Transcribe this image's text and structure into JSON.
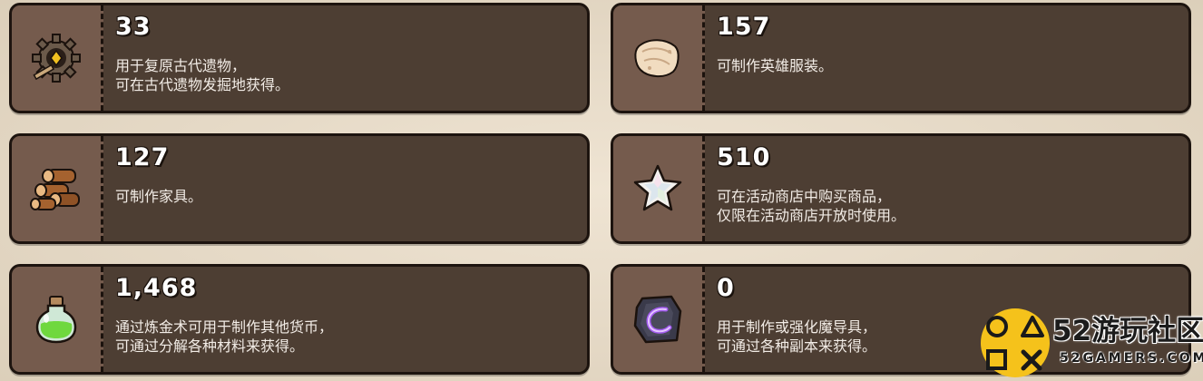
{
  "currencies": [
    {
      "amount": "33",
      "lines": [
        "用于复原古代遗物，",
        "可在古代遗物发掘地获得。"
      ],
      "icon": "relic-gear-icon"
    },
    {
      "amount": "157",
      "lines": [
        "可制作英雄服装。"
      ],
      "icon": "cloth-scroll-icon"
    },
    {
      "amount": "127",
      "lines": [
        "可制作家具。"
      ],
      "icon": "wood-logs-icon"
    },
    {
      "amount": "510",
      "lines": [
        "可在活动商店中购买商品，",
        "仅限在活动商店开放时使用。"
      ],
      "icon": "crystal-star-icon"
    },
    {
      "amount": "1,468",
      "lines": [
        "通过炼金术可用于制作其他货币，",
        "可通过分解各种材料来获得。"
      ],
      "icon": "green-potion-icon"
    },
    {
      "amount": "0",
      "lines": [
        "用于制作或强化魔导具，",
        "可通过各种副本来获得。"
      ],
      "icon": "magic-stone-icon"
    }
  ],
  "watermark": {
    "title": "52游玩社区",
    "subtitle": "52GAMERS.COM"
  },
  "colors": {
    "card_bg": "#4d3e33",
    "icon_bg": "#755b4d",
    "border": "#1d140f",
    "text": "#ffffff"
  }
}
